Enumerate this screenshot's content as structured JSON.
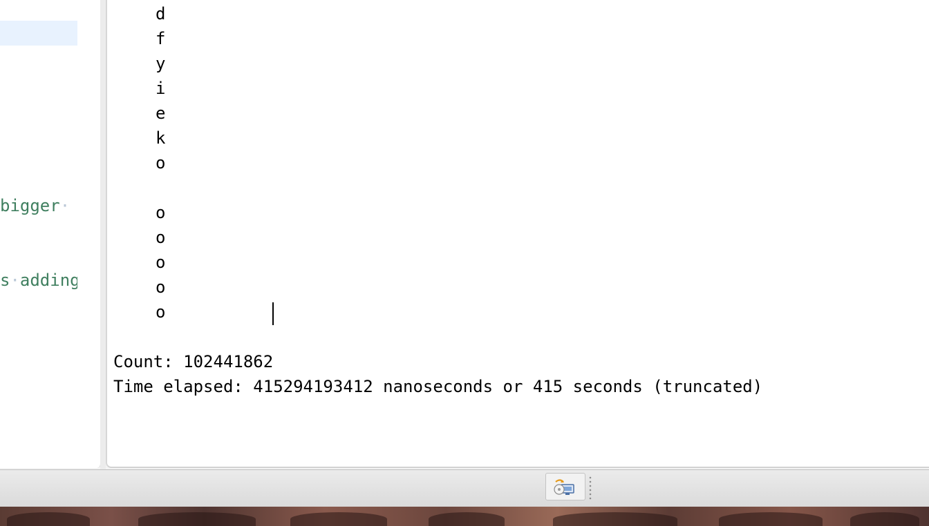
{
  "editor": {
    "code_line_1": {
      "text": "bigger",
      "trail": "·"
    },
    "code_line_2": {
      "lead": "s",
      "sep": "·",
      "text": "adding"
    }
  },
  "console": {
    "chars": [
      "d",
      "f",
      "y",
      "i",
      "e",
      "k",
      "o",
      "",
      "o",
      "o",
      "o",
      "o",
      "o"
    ],
    "count_line": "Count: 102441862",
    "time_line": "Time elapsed: 415294193412 nanoseconds or 415 seconds (truncated)"
  },
  "status_bar": {
    "button_icon": "sync-monitor-icon",
    "separator_icon": "grip-dots-icon"
  },
  "colors": {
    "comment_green": "#3f7f5f",
    "selection_highlight": "#e8f2fe"
  }
}
